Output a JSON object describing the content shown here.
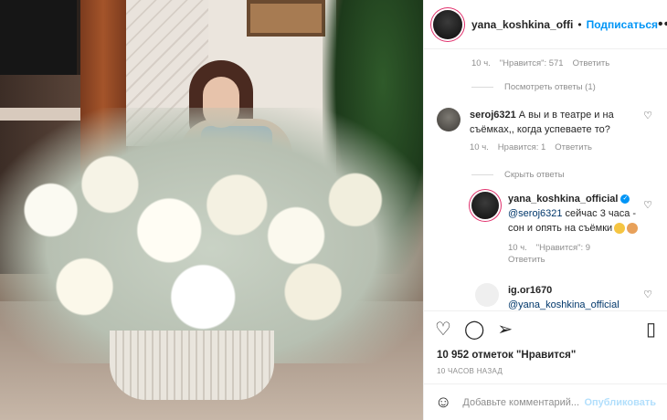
{
  "header": {
    "username": "yana_koshkina_offi",
    "separator": "•",
    "follow_label": "Подписаться",
    "more_icon": "more-horizontal-icon"
  },
  "thread": {
    "top_meta": {
      "time": "10 ч.",
      "likes": "\"Нравится\": 571",
      "reply": "Ответить"
    },
    "view_replies": "Посмотреть ответы (1)",
    "comment1": {
      "username": "seroj6321",
      "text": "А вы и в театре и на съёмках,, когда успеваете то?",
      "time": "10 ч.",
      "likes": "Нравится: 1",
      "reply": "Ответить"
    },
    "hide_replies": "Скрыть ответы",
    "reply1": {
      "username": "yana_koshkina_official",
      "mention": "@seroj6321",
      "text": " сейчас 3 часа - сон и опять на съёмки",
      "time": "10 ч.",
      "likes": "\"Нравится\": 9",
      "reply": "Ответить"
    },
    "comment2": {
      "username": "ig.or1670",
      "mention": "@yana_koshkina_official"
    }
  },
  "actions": {
    "like_icon": "heart-icon",
    "comment_icon": "comment-icon",
    "share_icon": "share-icon",
    "save_icon": "bookmark-icon"
  },
  "likes_text": "10 952 отметок \"Нравится\"",
  "time_text": "10 часов назад",
  "add_comment": {
    "placeholder": "Добавьте комментарий...",
    "publish_label": "Опубликовать"
  },
  "colors": {
    "accent": "#0095f6",
    "mention": "#00376b",
    "muted": "#8e8e8e",
    "publish_disabled": "#b2dffc"
  }
}
